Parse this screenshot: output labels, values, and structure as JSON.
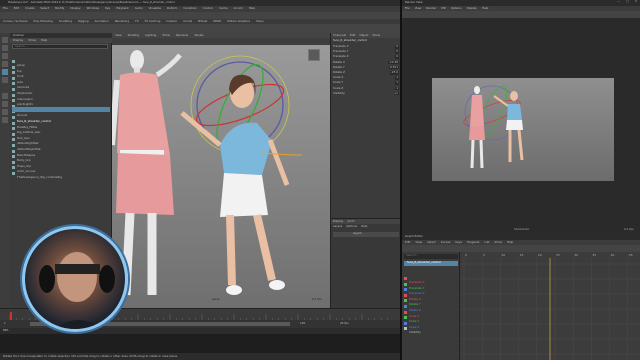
{
  "maya": {
    "title": "PoseScene.ma* - Autodesk MAYA 2024.2: D:\\OneDrive\\Animation\\PoseAgency\\Scenes\\PoseScene.ma --- face_R_shoulder_control",
    "menus": [
      "File",
      "Edit",
      "Create",
      "Select",
      "Modify",
      "Display",
      "Windows",
      "Key",
      "Playback",
      "Audio",
      "Visualize",
      "Deform",
      "Constrain",
      "Control",
      "Cache",
      "Arnold",
      "Help"
    ],
    "shelf_tabs": [
      "Curves / Surfaces",
      "Poly Modeling",
      "Sculpting",
      "Rigging",
      "Animation",
      "Rendering",
      "FX",
      "FX Caching",
      "Custom",
      "Arnold",
      "Bifrost",
      "MASH",
      "Motion Graphics",
      "XGen"
    ],
    "outliner": {
      "title": "Outliner",
      "menus": [
        "Display",
        "Show",
        "Help"
      ],
      "search_placeholder": "Search...",
      "items": [
        {
          "label": "persp",
          "selected": false
        },
        {
          "label": "top",
          "selected": false
        },
        {
          "label": "front",
          "selected": false
        },
        {
          "label": "side",
          "selected": false
        },
        {
          "label": "camera1",
          "selected": false
        },
        {
          "label": "StudioCam",
          "selected": false
        },
        {
          "label": "mannequin",
          "selected": false
        },
        {
          "label": "pointLight1",
          "selected": false
        },
        {
          "label": "directional",
          "selected": false
        },
        {
          "label": "Ground",
          "selected": false
        },
        {
          "label": "face_R_shoulder_control",
          "selected": true
        },
        {
          "label": "PoseRig_HiRes",
          "selected": false
        },
        {
          "label": "Rig_Clothes_Geo",
          "selected": false
        },
        {
          "label": "Hair_Geo",
          "selected": false
        },
        {
          "label": "defaultLightSet",
          "selected": false
        },
        {
          "label": "defaultObjectSet",
          "selected": false
        },
        {
          "label": "BlendShapes",
          "selected": false
        },
        {
          "label": "Body_Grp",
          "selected": false
        },
        {
          "label": "Props_Grp",
          "selected": false
        },
        {
          "label": "Anim_Curves",
          "selected": false
        },
        {
          "label": "ThePoseAgency_Rig_controlsRig",
          "selected": false
        }
      ]
    },
    "viewport": {
      "menus": [
        "View",
        "Shading",
        "Lighting",
        "Show",
        "Renderer",
        "Panels"
      ],
      "camera_label": "persp",
      "fps": "0.1 fps"
    },
    "channel_box": {
      "title": "face_R_shoulder_control",
      "tabs": [
        "Channels",
        "Edit",
        "Object",
        "Show"
      ],
      "attributes": [
        {
          "name": "Translate X",
          "value": "0"
        },
        {
          "name": "Translate Y",
          "value": "0"
        },
        {
          "name": "Translate Z",
          "value": "0"
        },
        {
          "name": "Rotate X",
          "value": "-12.48"
        },
        {
          "name": "Rotate Y",
          "value": "8.351"
        },
        {
          "name": "Rotate Z",
          "value": "-23.6"
        },
        {
          "name": "Scale X",
          "value": "1"
        },
        {
          "name": "Scale Y",
          "value": "1"
        },
        {
          "name": "Scale Z",
          "value": "1"
        },
        {
          "name": "Visibility",
          "value": "on"
        }
      ],
      "layer_tabs": [
        "Display",
        "Anim"
      ],
      "layer_menus": [
        "Layers",
        "Options",
        "Help"
      ],
      "layer_item": "layer1"
    },
    "status_line": "Rotate Tool: Use manipulator to rotate object(s). Ctrl+middle-drag to rotate in other axes. Shift+drag to rotate in view plane."
  },
  "render_view": {
    "title": "Render View",
    "menus": [
      "File",
      "View",
      "Render",
      "IPR",
      "Options",
      "Display",
      "Help"
    ],
    "camera": "StudioCam",
    "fps": "0.1 fps"
  },
  "graph_editor": {
    "title": "Graph Editor",
    "menus": [
      "Edit",
      "View",
      "Select",
      "Curves",
      "Keys",
      "Tangents",
      "List",
      "Show",
      "Help"
    ],
    "search_placeholder": "Search...",
    "selected": "face_R_shoulder_control",
    "channels": [
      {
        "label": "Translate X",
        "color": "#e05050"
      },
      {
        "label": "Translate Y",
        "color": "#50c050"
      },
      {
        "label": "Translate Z",
        "color": "#5080e0"
      },
      {
        "label": "Rotate X",
        "color": "#e05050"
      },
      {
        "label": "Rotate Y",
        "color": "#50c050"
      },
      {
        "label": "Rotate Z",
        "color": "#5080e0"
      },
      {
        "label": "Scale X",
        "color": "#e05050"
      },
      {
        "label": "Scale Y",
        "color": "#50c050"
      },
      {
        "label": "Scale Z",
        "color": "#5080e0"
      },
      {
        "label": "Visibility",
        "color": "#bbbbbb"
      }
    ],
    "frame_labels": [
      "0",
      "5",
      "10",
      "15",
      "20",
      "25",
      "30",
      "35",
      "40",
      "45"
    ]
  },
  "timeline": {
    "start": "1",
    "end": "120",
    "current": "1",
    "fps_setting": "24 fps"
  },
  "colors": {
    "accent": "#5285a6",
    "selected": "#5285a6",
    "panel": "#444444",
    "viewport_bg": "#8a8a8a"
  }
}
